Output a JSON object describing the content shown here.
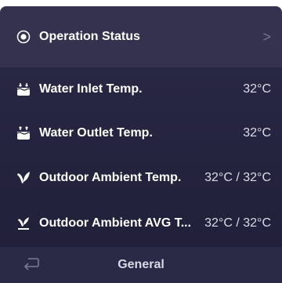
{
  "rows": [
    {
      "label": "Operation Status",
      "icon": "radio-status-icon",
      "chevron": ">"
    },
    {
      "label": "Water Inlet Temp.",
      "value": "32°C",
      "icon": "water-inlet-icon"
    },
    {
      "label": "Water Outlet Temp.",
      "value": "32°C",
      "icon": "water-outlet-icon"
    },
    {
      "label": "Outdoor Ambient Temp.",
      "value": "32°C / 32°C",
      "icon": "leaf-icon"
    },
    {
      "label": "Outdoor Ambient  AVG T...",
      "value": "32°C / 32°C",
      "icon": "leaf-avg-icon"
    }
  ],
  "bottom_bar": {
    "title": "General",
    "back_icon": "back-arrow-icon"
  },
  "colors": {
    "background": "#262541",
    "selected_row": "#34324f",
    "text": "#ffffff"
  }
}
